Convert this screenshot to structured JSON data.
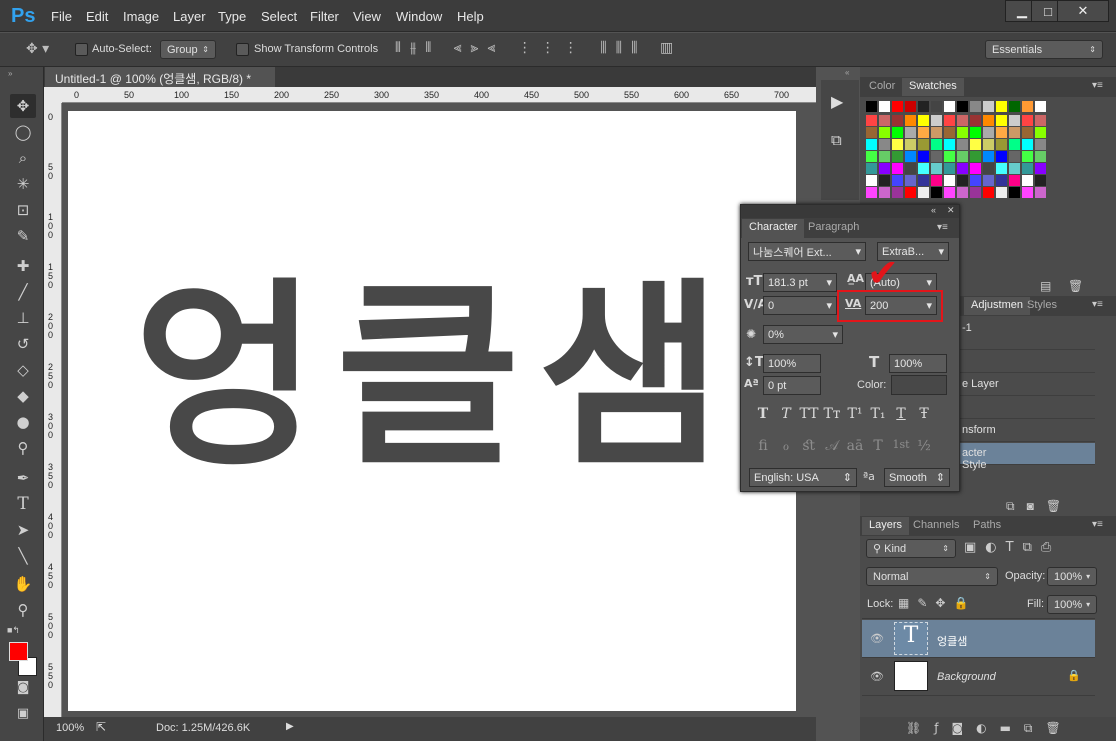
{
  "menubar": {
    "logo": "Ps",
    "items": [
      "File",
      "Edit",
      "Image",
      "Layer",
      "Type",
      "Select",
      "Filter",
      "View",
      "Window",
      "Help"
    ],
    "min": "▁",
    "max": "□",
    "close": "✕"
  },
  "options": {
    "auto_select_label": "Auto-Select:",
    "auto_select_value": "Group",
    "show_transform_label": "Show Transform Controls",
    "workspace": "Essentials"
  },
  "document": {
    "tab_title": "Untitled-1 @ 100% (엉클샘, RGB/8) *",
    "tab_close": "×",
    "canvas_text": [
      "엉",
      "클",
      "샘"
    ],
    "text_color": "#484848"
  },
  "ruler": {
    "h_ticks": [
      "0",
      "50",
      "100",
      "150",
      "200",
      "250",
      "300",
      "350",
      "400",
      "450",
      "500",
      "550",
      "600",
      "650",
      "700"
    ],
    "v_ticks": [
      "0",
      "50",
      "100",
      "150",
      "200",
      "250",
      "300",
      "350",
      "400",
      "450",
      "500",
      "550"
    ]
  },
  "status": {
    "zoom": "100%",
    "doc": "Doc: 1.25M/426.6K"
  },
  "tools": [
    "move-tool",
    "marquee-tool",
    "lasso-tool",
    "magic-wand-tool",
    "crop-tool",
    "eyedropper-tool",
    "healing-brush-tool",
    "brush-tool",
    "clone-stamp-tool",
    "history-brush-tool",
    "eraser-tool",
    "paint-bucket-tool",
    "blur-tool",
    "dodge-tool",
    "pen-tool",
    "type-tool",
    "path-selection-tool",
    "line-tool",
    "hand-tool",
    "zoom-tool"
  ],
  "colors": {
    "foreground": "#ff0000",
    "background": "#ffffff",
    "accent": "#32a2ee",
    "highlight_row": "#6b8299",
    "annotation_red": "#e3151a"
  },
  "swatch_panel": {
    "tabs": [
      "Color",
      "Swatches"
    ],
    "active_tab": "Swatches"
  },
  "character": {
    "tabs": [
      "Character",
      "Paragraph"
    ],
    "font_family": "나눔스퀘어 Ext...",
    "font_style": "ExtraB...",
    "size": "181.3 pt",
    "leading": "(Auto)",
    "kerning": "0",
    "tracking": "200",
    "vscale_percent": "0%",
    "vertical_scale": "100%",
    "horizontal_scale": "100%",
    "baseline": "0 pt",
    "color_label": "Color:",
    "language": "English: USA",
    "antialias_label": "ªa",
    "antialias": "Smooth",
    "format_buttons": [
      "T",
      "T",
      "TT",
      "Tт",
      "T¹",
      "T₁",
      "T",
      "Ŧ"
    ],
    "opentype_buttons": [
      "ﬁ",
      "ℴ",
      "ﬆ",
      "𝒜",
      "aā",
      "T",
      "1st",
      "½"
    ]
  },
  "adjust_panel": {
    "tabs": [
      "Adjustmen",
      "Styles"
    ],
    "history": [
      "-1",
      "",
      "e Layer",
      "",
      "nsform",
      "acter Style"
    ]
  },
  "layers_panel": {
    "tabs": [
      "Layers",
      "Channels",
      "Paths"
    ],
    "filter": "Kind",
    "blend_mode": "Normal",
    "opacity_label": "Opacity:",
    "opacity": "100%",
    "lock_label": "Lock:",
    "fill_label": "Fill:",
    "fill": "100%",
    "layers": [
      {
        "name": "엉클샘",
        "type_icon": "T"
      },
      {
        "name": "Background"
      }
    ]
  }
}
